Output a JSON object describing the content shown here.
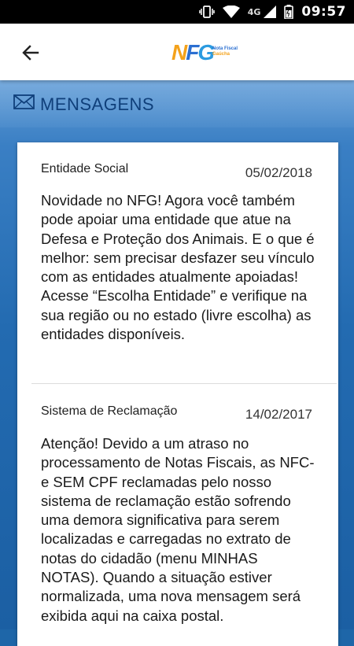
{
  "status_bar": {
    "network": "4G",
    "time": "09:57"
  },
  "header": {
    "logo_text": "NFG",
    "logo_subtitle_line1": "Nota Fiscal",
    "logo_subtitle_line2": "Gaúcha"
  },
  "section": {
    "title": "MENSAGENS"
  },
  "messages": [
    {
      "subject": "Entidade Social",
      "date": "05/02/2018",
      "body": "Novidade no NFG! Agora você também pode apoiar uma entidade que atue na Defesa e Proteção dos Animais. E o que é melhor: sem precisar desfazer seu vínculo com as entidades atualmente apoiadas! Acesse “Escolha Entidade” e verifique na sua região ou no estado (livre escolha) as entidades disponíveis."
    },
    {
      "subject": "Sistema de Reclamação",
      "date": "14/02/2017",
      "body": "Atenção! Devido a um atraso no processamento de Notas Fiscais, as NFC-e SEM CPF reclamadas pelo nosso sistema de reclamação estão sofrendo uma demora significativa para serem localizadas e carregadas no extrato de notas do cidadão (menu MINHAS NOTAS). Quando a situação estiver normalizada, uma nova mensagem será exibida aqui na caixa postal."
    }
  ],
  "colors": {
    "app_bar": "#ffffff",
    "background_blue": "#1e66a8",
    "section_title": "#0f3f7a",
    "logo_orange": "#f4a21b",
    "logo_blue": "#2b6fd1"
  }
}
